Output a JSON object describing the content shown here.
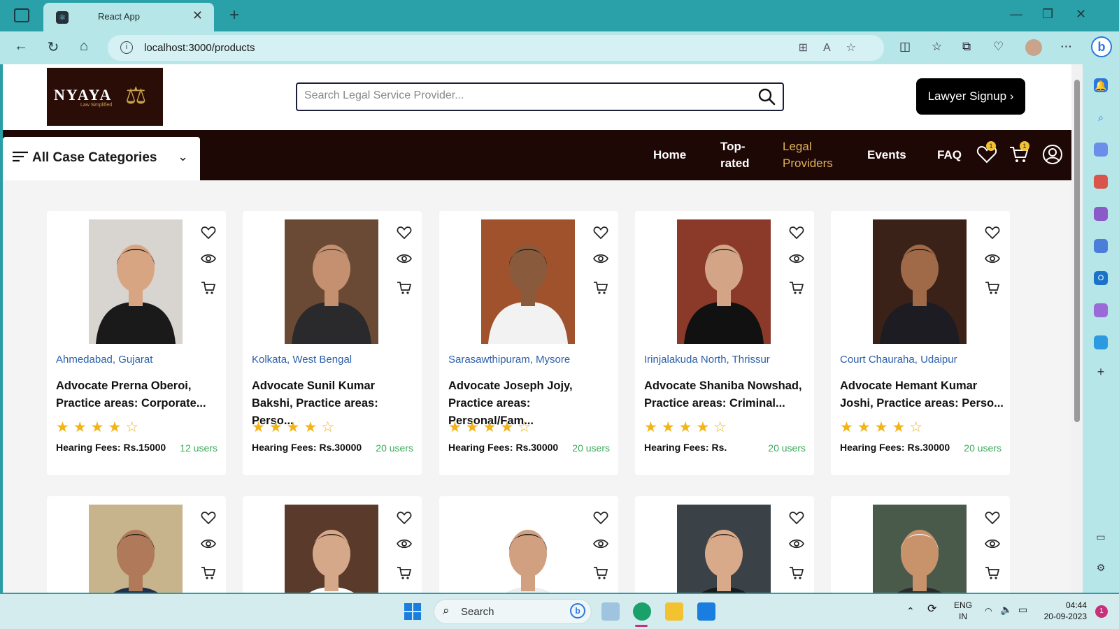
{
  "browser": {
    "tab_title": "React App",
    "tab_close": "✕",
    "new_tab": "+",
    "url": "localhost:3000/products"
  },
  "site": {
    "logo_text": "NYAYA",
    "logo_tagline": "Law Simplified",
    "search_placeholder": "Search Legal Service Provider...",
    "signup_label": "Lawyer Signup  ›",
    "categories_label": "All Case Categories",
    "nav": [
      {
        "label": "Home",
        "active": false
      },
      {
        "label": "Top-rated",
        "active": false
      },
      {
        "label": "Legal Providers",
        "active": true
      },
      {
        "label": "Events",
        "active": false
      },
      {
        "label": "FAQ",
        "active": false
      }
    ],
    "wishlist_count": "1",
    "cart_count": "1"
  },
  "cards": [
    {
      "location": "Ahmedabad, Gujarat",
      "name": "Advocate Prerna Oberoi, Practice areas: Corporate...",
      "rating": 4,
      "fee": "Hearing Fees: Rs.15000",
      "users": "12 users",
      "photo": {
        "bg": "#d8d4d0",
        "suit": "#1a1a1a",
        "skin": "#d8a583",
        "hair": "#1a0e0a"
      }
    },
    {
      "location": "Kolkata, West Bengal",
      "name": "Advocate Sunil Kumar Bakshi, Practice areas: Perso...",
      "rating": 4,
      "fee": "Hearing Fees: Rs.30000",
      "users": "20 users",
      "photo": {
        "bg": "#6b4a35",
        "suit": "#2a2a2c",
        "skin": "#c49070",
        "hair": "#3a3a3a"
      }
    },
    {
      "location": "Sarasawthipuram, Mysore",
      "name": "Advocate Joseph Jojy, Practice areas: Personal/Fam...",
      "rating": 4,
      "fee": "Hearing Fees: Rs.30000",
      "users": "20 users",
      "photo": {
        "bg": "#a0522d",
        "suit": "#f2f2f2",
        "skin": "#8a5a3c",
        "hair": "#1a1a1a"
      }
    },
    {
      "location": "Irinjalakuda North, Thrissur",
      "name": "Advocate Shaniba Nowshad, Practice areas: Criminal...",
      "rating": 4,
      "fee": "Hearing Fees: Rs.",
      "users": "20 users",
      "photo": {
        "bg": "#8b3a2a",
        "suit": "#111111",
        "skin": "#d4a486",
        "hair": "#1e1e1e"
      }
    },
    {
      "location": "Court Chauraha, Udaipur",
      "name": "Advocate Hemant Kumar Joshi, Practice areas: Perso...",
      "rating": 4,
      "fee": "Hearing Fees: Rs.30000",
      "users": "20 users",
      "photo": {
        "bg": "#3a2218",
        "suit": "#1c1c22",
        "skin": "#a06a48",
        "hair": "#101010"
      }
    },
    {
      "location": "",
      "name": "",
      "rating": 0,
      "fee": "",
      "users": "",
      "photo": {
        "bg": "#c8b48c",
        "suit": "#22304a",
        "skin": "#b07a5a",
        "hair": "#1a1a1a"
      }
    },
    {
      "location": "",
      "name": "",
      "rating": 0,
      "fee": "",
      "users": "",
      "photo": {
        "bg": "#5a3a2a",
        "suit": "#ffffff",
        "skin": "#d6a88a",
        "hair": "#2a1a12"
      }
    },
    {
      "location": "",
      "name": "",
      "rating": 0,
      "fee": "",
      "users": "",
      "photo": {
        "bg": "#ffffff",
        "suit": "#eeeeee",
        "skin": "#d0a080",
        "hair": "#141414"
      }
    },
    {
      "location": "",
      "name": "",
      "rating": 0,
      "fee": "",
      "users": "",
      "photo": {
        "bg": "#3a4248",
        "suit": "#1a1a1a",
        "skin": "#d8aa8a",
        "hair": "#2a1a12"
      }
    },
    {
      "location": "",
      "name": "",
      "rating": 0,
      "fee": "",
      "users": "",
      "photo": {
        "bg": "#4a5a4a",
        "suit": "#2a2a2a",
        "skin": "#c8926a",
        "hair": "#f2f2f2"
      }
    }
  ],
  "taskbar": {
    "search_label": "Search",
    "lang_top": "ENG",
    "lang_bottom": "IN",
    "time": "04:44",
    "date": "20-09-2023",
    "notif_count": "1"
  },
  "colors": {
    "accent": "#e0b25a",
    "navbar": "#1e0806",
    "location": "#2b5faa",
    "users": "#3aaa5a",
    "star": "#f2b416"
  }
}
